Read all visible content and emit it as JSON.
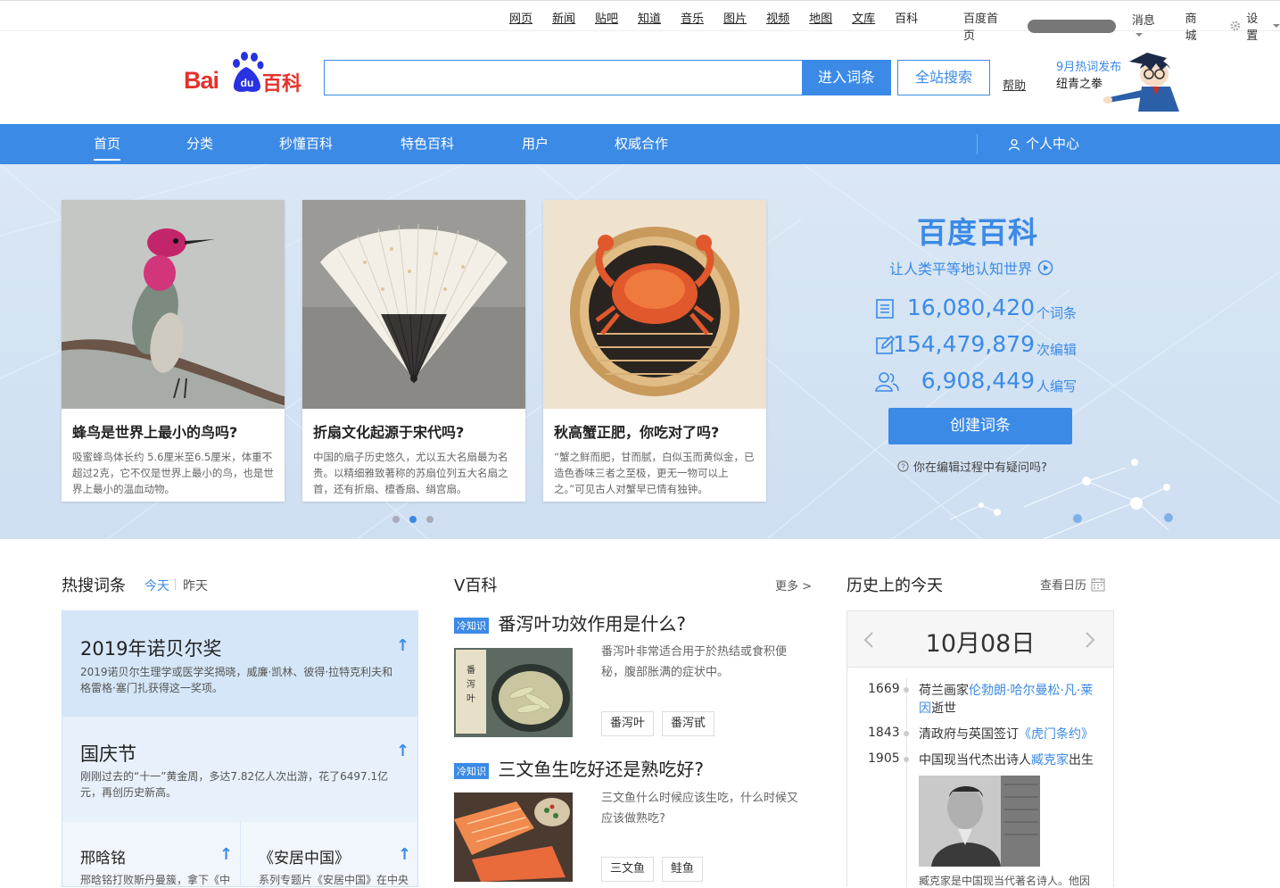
{
  "topnav": {
    "links": [
      "网页",
      "新闻",
      "贴吧",
      "知道",
      "音乐",
      "图片",
      "视频",
      "地图",
      "文库",
      "百科"
    ],
    "home": "百度首页",
    "messages": "消息",
    "mall": "商城",
    "settings": "设置"
  },
  "header": {
    "logo_text": "Bai",
    "logo_du": "du",
    "logo_baike": "百科",
    "search_placeholder": "",
    "enter_button": "进入词条",
    "search_all_button": "全站搜索",
    "help": "帮助",
    "promo_line1": "9月热词发布",
    "promo_line2": "纽青之拳"
  },
  "nav": {
    "items": [
      "首页",
      "分类",
      "秒懂百科",
      "特色百科",
      "用户",
      "权威合作"
    ],
    "personal": "个人中心"
  },
  "hero": {
    "cards": [
      {
        "title": "蜂鸟是世界上最小的鸟吗?",
        "desc": "吸蜜蜂鸟体长约 5.6厘米至6.5厘米，体重不超过2克，它不仅是世界上最小的鸟，也是世界上最小的温血动物。"
      },
      {
        "title": "折扇文化起源于宋代吗?",
        "desc": "中国的扇子历史悠久，尤以五大名扇最为名贵。以精细雅致著称的苏扇位列五大名扇之首，还有折扇、檀香扇、绢宫扇。"
      },
      {
        "title": "秋高蟹正肥，你吃对了吗?",
        "desc": "“蟹之鲜而肥，甘而腻，白似玉而黄似金，已造色香味三者之至极，更无一物可以上之。”可见古人对蟹早已情有独钟。"
      }
    ],
    "brand": "百度百科",
    "slogan": "让人类平等地认知世界",
    "stats": [
      {
        "num": "16,080,420",
        "unit": "个词条",
        "icon": "list-icon"
      },
      {
        "num": "154,479,879",
        "unit": "次编辑",
        "icon": "edit-icon"
      },
      {
        "num": "6,908,449",
        "unit": "人编写",
        "icon": "users-icon"
      }
    ],
    "create_button": "创建词条",
    "question": "你在编辑过程中有疑问吗?"
  },
  "hotsearch": {
    "title": "热搜词条",
    "tab_today": "今天",
    "tab_yesterday": "昨天",
    "items": [
      {
        "title": "2019年诺贝尔奖",
        "desc": "2019诺贝尔生理学或医学奖揭晓，威廉·凯林、彼得·拉特克利夫和格雷格·塞门扎获得这一奖项。"
      },
      {
        "title": "国庆节",
        "desc": "刚刚过去的“十一”黄金周，多达7.82亿人次出游，花了6497.1亿元，再创历史新高。"
      },
      {
        "title": "邢晗铭",
        "desc": "邢晗铭打败斯丹曼簇，拿下《中"
      },
      {
        "title": "《安居中国》",
        "desc": "系列专题片《安居中国》在中央"
      }
    ]
  },
  "vbaike": {
    "title": "V百科",
    "more": "更多 >",
    "tag_label": "冷知识",
    "items": [
      {
        "title": "番泻叶功效作用是什么?",
        "desc": "番泻叶非常适合用于於热结或食积便秘，腹部胀满的症状中。",
        "tags": [
          "番泻叶",
          "番泻甙"
        ]
      },
      {
        "title": "三文鱼生吃好还是熟吃好?",
        "desc": "三文鱼什么时候应该生吃，什么时候又应该做熟吃?",
        "tags": [
          "三文鱼",
          "鲑鱼"
        ]
      }
    ]
  },
  "history": {
    "title": "历史上的今天",
    "calendar_link": "查看日历",
    "date": "10月08日",
    "events": [
      {
        "year": "1669",
        "pre": "荷兰画家",
        "link": "伦勃朗·哈尔曼松·凡·莱因",
        "post": "逝世"
      },
      {
        "year": "1843",
        "pre": "清政府与英国签订",
        "link": "《虎门条约》",
        "post": ""
      },
      {
        "year": "1905",
        "pre": "中国现当代杰出诗人",
        "link": "臧克家",
        "post": "出生"
      }
    ],
    "caption": "臧克家是中国现当代著名诗人。他因"
  },
  "colors": {
    "accent": "#3b8ae6",
    "brand_red": "#e4322b"
  }
}
